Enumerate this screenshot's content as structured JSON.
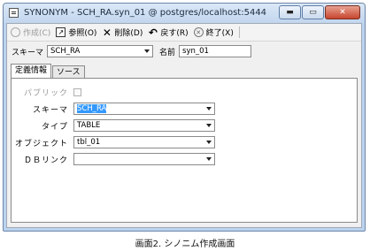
{
  "window": {
    "title": "SYNONYM - SCH_RA.syn_01 @ postgres/localhost:5444",
    "minimize": "▬",
    "maximize": "▭",
    "close": "✕"
  },
  "toolbar": {
    "create_label": "作成(C)",
    "reference_label": "参照(O)",
    "delete_label": "削除(D)",
    "back_label": "戻す(R)",
    "exit_label": "終了(X)"
  },
  "header": {
    "schema_label": "スキーマ",
    "schema_value": "SCH_RA",
    "name_label": "名前",
    "name_value": "syn_01"
  },
  "tabs": [
    {
      "label": "定義情報",
      "active": true
    },
    {
      "label": "ソース",
      "active": false
    }
  ],
  "form": {
    "public_label": "パブリック",
    "schema_label": "スキーマ",
    "schema_value": "SCH_RA",
    "type_label": "タイプ",
    "type_value": "TABLE",
    "object_label": "オブジェクト",
    "object_value": "tbl_01",
    "dblink_label": "ＤＢリンク",
    "dblink_value": ""
  },
  "caption": "画面2. シノニム作成画面"
}
